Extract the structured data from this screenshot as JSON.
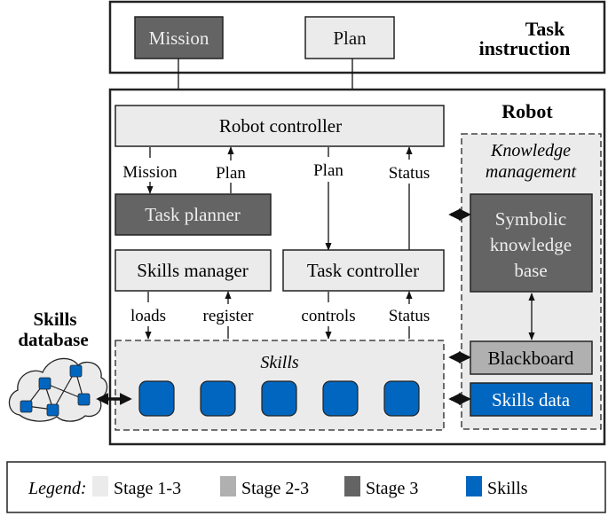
{
  "colors": {
    "stage_1_3": "#ebebeb",
    "stage_2_3": "#b0b0b0",
    "stage_3": "#646464",
    "skills": "#0066bf",
    "border": "#222222"
  },
  "task_instruction": {
    "title_line1": "Task",
    "title_line2": "instruction",
    "mission": "Mission",
    "plan": "Plan"
  },
  "robot": {
    "title": "Robot",
    "robot_controller": "Robot controller",
    "task_planner": "Task planner",
    "skills_manager": "Skills manager",
    "task_controller": "Task controller",
    "edges": {
      "mission": "Mission",
      "plan_up": "Plan",
      "plan_down": "Plan",
      "status_up": "Status",
      "loads": "loads",
      "register": "register",
      "controls": "controls",
      "status_skills": "Status"
    },
    "skills_group": {
      "title": "Skills",
      "skill_count": 5
    },
    "knowledge": {
      "title_line1": "Knowledge",
      "title_line2": "management",
      "kb_line1": "Symbolic",
      "kb_line2": "knowledge",
      "kb_line3": "base",
      "blackboard": "Blackboard",
      "skills_data": "Skills data"
    }
  },
  "skills_database": {
    "title_line1": "Skills",
    "title_line2": "database"
  },
  "legend": {
    "label": "Legend:",
    "items": [
      {
        "label": "Stage 1-3",
        "color": "#ebebeb"
      },
      {
        "label": "Stage 2-3",
        "color": "#b0b0b0"
      },
      {
        "label": "Stage 3",
        "color": "#646464"
      },
      {
        "label": "Skills",
        "color": "#0066bf"
      }
    ]
  }
}
